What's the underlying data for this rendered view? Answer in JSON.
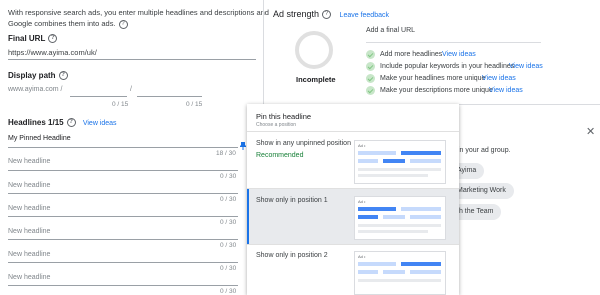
{
  "intro": {
    "line1": "With responsive search ads, you enter multiple headlines and descriptions and",
    "line2": "Google combines them into ads."
  },
  "final_url": {
    "label": "Final URL",
    "value": "https://www.ayima.com/uk/"
  },
  "display_path": {
    "label": "Display path",
    "domain": "www.ayima.com /",
    "separator": "/",
    "counter1": "0 / 15",
    "counter2": "0 / 15"
  },
  "headlines": {
    "label": "Headlines 1/15",
    "view_ideas": "View ideas",
    "rows": [
      {
        "value": "My Pinned Headline",
        "placeholder": "",
        "counter": "18 / 30"
      },
      {
        "value": "",
        "placeholder": "New headline",
        "counter": "0 / 30"
      },
      {
        "value": "",
        "placeholder": "New headline",
        "counter": "0 / 30"
      },
      {
        "value": "",
        "placeholder": "New headline",
        "counter": "0 / 30"
      },
      {
        "value": "",
        "placeholder": "New headline",
        "counter": "0 / 30"
      },
      {
        "value": "",
        "placeholder": "New headline",
        "counter": "0 / 30"
      },
      {
        "value": "",
        "placeholder": "New headline",
        "counter": "0 / 30"
      }
    ]
  },
  "ad_strength": {
    "title": "Ad strength",
    "leave_feedback": "Leave feedback",
    "status": "Incomplete",
    "add_url": "Add a final URL",
    "suggestions": [
      {
        "text": "Add more headlines",
        "link": "View ideas"
      },
      {
        "text": "Include popular keywords in your headlines",
        "link": "View ideas"
      },
      {
        "text": "Make your headlines more unique",
        "link": "View ideas"
      },
      {
        "text": "Make your descriptions more unique",
        "link": "View ideas"
      }
    ]
  },
  "background_panel": {
    "text": "in your ad group.",
    "chips": [
      "Ayima",
      "Marketing Work",
      "th the Team"
    ]
  },
  "pin_popup": {
    "title": "Pin this headline",
    "subtitle": "Choose a position",
    "options": [
      {
        "label": "Show in any unpinned position",
        "sublabel": "Recommended"
      },
      {
        "label": "Show only in position 1",
        "sublabel": ""
      },
      {
        "label": "Show only in position 2",
        "sublabel": ""
      }
    ],
    "preview_tag": "Ad •"
  },
  "colors": {
    "accent": "#1a73e8",
    "recommended": "#188038",
    "light_blue": "#c6dafc",
    "selected_bg": "#e8eaed",
    "check_green": "#c8e6c9"
  },
  "icons": [
    "help-icon",
    "pin-icon",
    "close-icon",
    "check-circle-icon"
  ]
}
